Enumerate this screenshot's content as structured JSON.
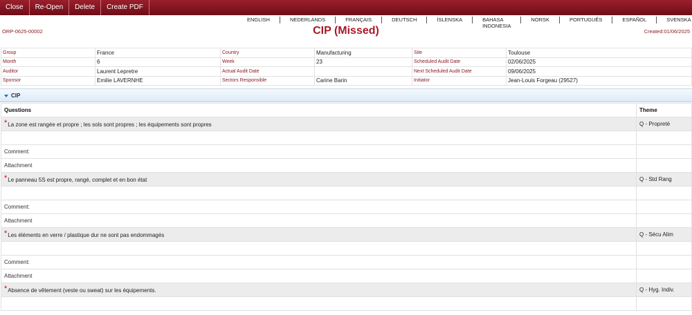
{
  "toolbar": {
    "close": "Close",
    "reopen": "Re-Open",
    "delete": "Delete",
    "create_pdf": "Create PDF"
  },
  "languages": [
    "ENGLISH",
    "NEDERLANDS",
    "FRANÇAIS",
    "DEUTSCH",
    "ÍSLENSKA",
    "BAHASA INDONESIA",
    "NORSK",
    "PORTUGUÊS",
    "ESPAÑOL",
    "SVENSKA"
  ],
  "header": {
    "ref": "ORP-0625-00002",
    "title": "CIP (Missed)",
    "created": "Created:01/06/2025"
  },
  "info": {
    "group_label": "Group",
    "group": "France",
    "country_label": "Country",
    "country": "Manufacturing",
    "site_label": "Site",
    "site": "Toulouse",
    "month_label": "Month",
    "month": "6",
    "week_label": "Week",
    "week": "23",
    "scheduled_label": "Scheduled Audit Date",
    "scheduled": "02/06/2025",
    "auditor_label": "Auditor",
    "auditor": "Laurent Lepretre",
    "actual_label": "Actual Audit Date",
    "actual": "",
    "next_label": "Next Scheduled Audit Date",
    "next": "09/06/2025",
    "sponsor_label": "Sponsor",
    "sponsor": "Emilie LAVERNHE",
    "sectors_label": "Sectors Responsible",
    "sectors": "Carine Barin",
    "initiator_label": "Initiator",
    "initiator": "Jean-Louis Forgeau (29527)"
  },
  "section": {
    "label": "CIP"
  },
  "table": {
    "col_questions": "Questions",
    "col_theme": "Theme",
    "comment_label": "Comment:",
    "attachment_label": "Attachment",
    "required_mark": "*",
    "questions": [
      {
        "text": "La zone est rangée et propre ; les sols sont propres ; les équipements sont propres",
        "theme": "Q - Propreté"
      },
      {
        "text": "Le panneau 5S est propre, rangé, complet et en bon état",
        "theme": "Q - Std Rang"
      },
      {
        "text": "Les éléments en verre / plastique dur ne sont pas endommagés",
        "theme": "Q - Sécu Alim"
      },
      {
        "text": "Absence de vêtement (veste ou sweat) sur les équipements.",
        "theme": "Q - Hyg. Indiv."
      }
    ]
  }
}
